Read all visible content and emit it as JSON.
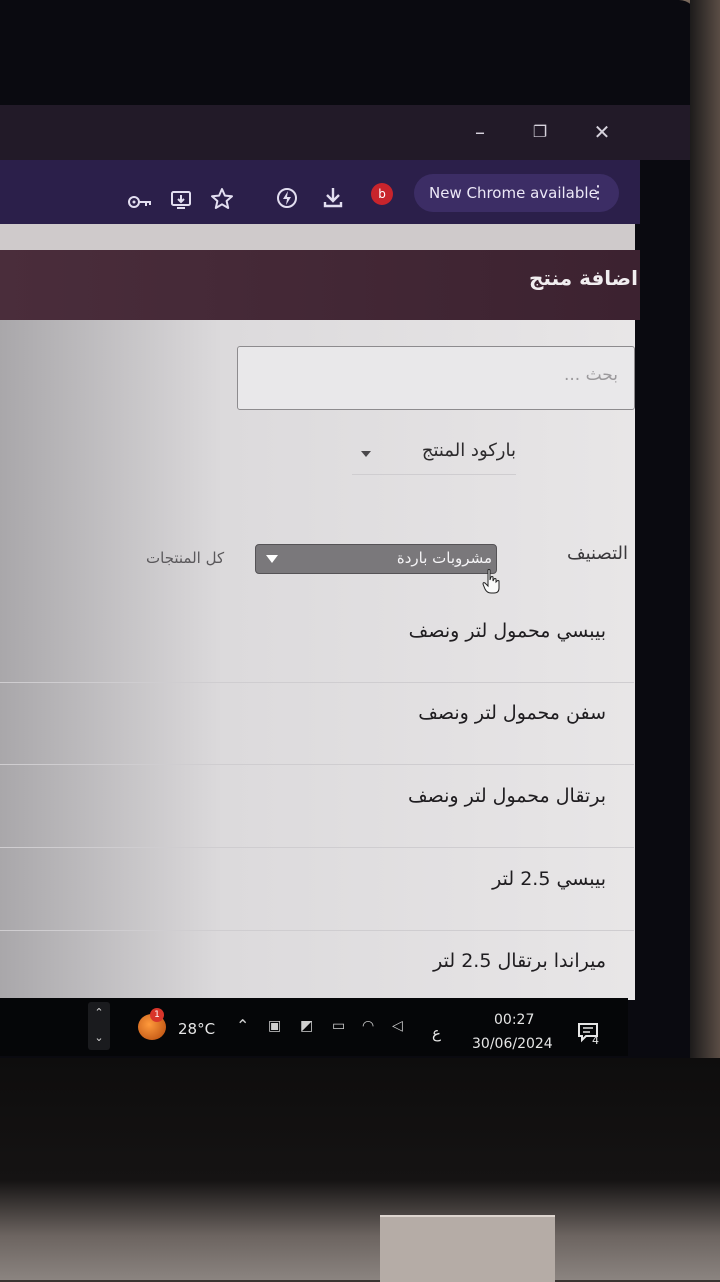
{
  "browser": {
    "window_controls": {
      "minimize": "–",
      "maximize": "❐",
      "close": "✕"
    },
    "profile_initial": "b",
    "update_label": "New Chrome available",
    "menu_icon": "⋮",
    "toolbar_icons": [
      "key-icon",
      "install-app-icon",
      "bookmark-star-icon",
      "extension-icon",
      "download-icon"
    ]
  },
  "header": {
    "title": "اضافة منتج"
  },
  "search": {
    "placeholder": "بحث ..."
  },
  "barcode": {
    "label": "باركود المنتج"
  },
  "category": {
    "label": "التصنيف",
    "selected": "مشروبات باردة",
    "all_label": "كل المنتجات"
  },
  "products": [
    {
      "name": "بيبسي محمول لتر ونصف"
    },
    {
      "name": "سفن محمول لتر ونصف"
    },
    {
      "name": "برتقال محمول لتر ونصف"
    },
    {
      "name": "بيبسي 2.5 لتر"
    },
    {
      "name": "ميراندا برتقال 2.5 لتر"
    }
  ],
  "taskbar": {
    "weather_badge": "1",
    "temperature": "28°C",
    "language": "ع",
    "time": "00:27",
    "date": "30/06/2024",
    "notifications_count": "4"
  }
}
